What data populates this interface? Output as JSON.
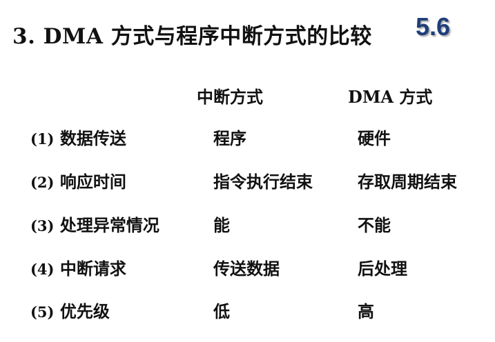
{
  "slide": {
    "title": "3. DMA 方式与程序中断方式的比较",
    "section_number": "5.6"
  },
  "table": {
    "headers": [
      "中断方式",
      "DMA 方式"
    ],
    "rows": [
      {
        "num": "(1)",
        "item": "数据传送",
        "interrupt": "程序",
        "dma": "硬件"
      },
      {
        "num": "(2)",
        "item": "响应时间",
        "interrupt": "指令执行结束",
        "dma": "存取周期结束"
      },
      {
        "num": "(3)",
        "item": "处理异常情况",
        "interrupt": "能",
        "dma": "不能"
      },
      {
        "num": "(4)",
        "item": "中断请求",
        "interrupt": "传送数据",
        "dma": "后处理"
      },
      {
        "num": "(5)",
        "item": "优先级",
        "interrupt": "低",
        "dma": "高"
      }
    ]
  }
}
